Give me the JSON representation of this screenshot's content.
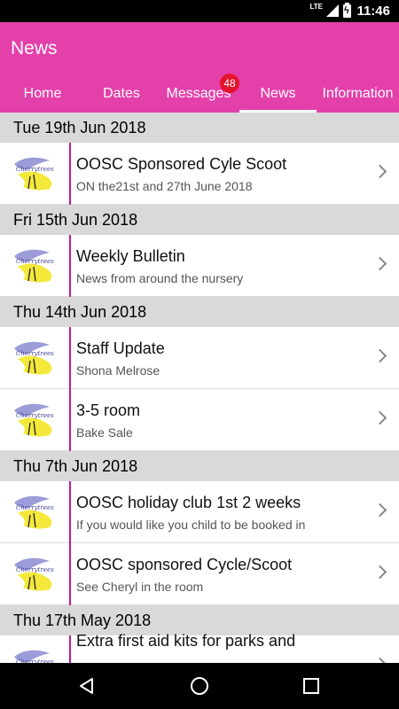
{
  "status_bar": {
    "time": "11:46",
    "network": "LTE"
  },
  "app": {
    "title": "News"
  },
  "tabs": [
    {
      "label": "Home"
    },
    {
      "label": "Dates"
    },
    {
      "label": "Messages",
      "badge": "48"
    },
    {
      "label": "News",
      "active": true
    },
    {
      "label": "Information"
    }
  ],
  "sections": [
    {
      "date": "Tue 19th Jun 2018",
      "items": [
        {
          "title": "OOSC Sponsored Cyle  Scoot",
          "subtitle": "ON the21st and 27th June 2018"
        }
      ]
    },
    {
      "date": "Fri 15th Jun 2018",
      "items": [
        {
          "title": "Weekly Bulletin",
          "subtitle": "News from around the nursery"
        }
      ]
    },
    {
      "date": "Thu 14th Jun 2018",
      "items": [
        {
          "title": "Staff Update",
          "subtitle": "Shona Melrose"
        },
        {
          "title": "3-5 room",
          "subtitle": "Bake Sale"
        }
      ]
    },
    {
      "date": "Thu 7th Jun 2018",
      "items": [
        {
          "title": "OOSC holiday club 1st 2 weeks",
          "subtitle": "If you would like you child to be booked in"
        },
        {
          "title": "OOSC sponsored Cycle/Scoot",
          "subtitle": "See Cheryl in the room"
        }
      ]
    },
    {
      "date": "Thu 17th May 2018",
      "items": [
        {
          "title": "Extra first aid kits for parks and",
          "subtitle": ""
        }
      ]
    }
  ],
  "logo_text": "Cherrytrees",
  "colors": {
    "appbar": "#e440aa",
    "accent_divider": "#c2189a",
    "badge": "#e4142c",
    "section_header": "#d9d9d9"
  },
  "icons": {
    "row_chevron": "chevron-right-icon",
    "nav_back": "back-icon",
    "nav_home": "home-icon",
    "nav_recent": "recent-apps-icon"
  }
}
